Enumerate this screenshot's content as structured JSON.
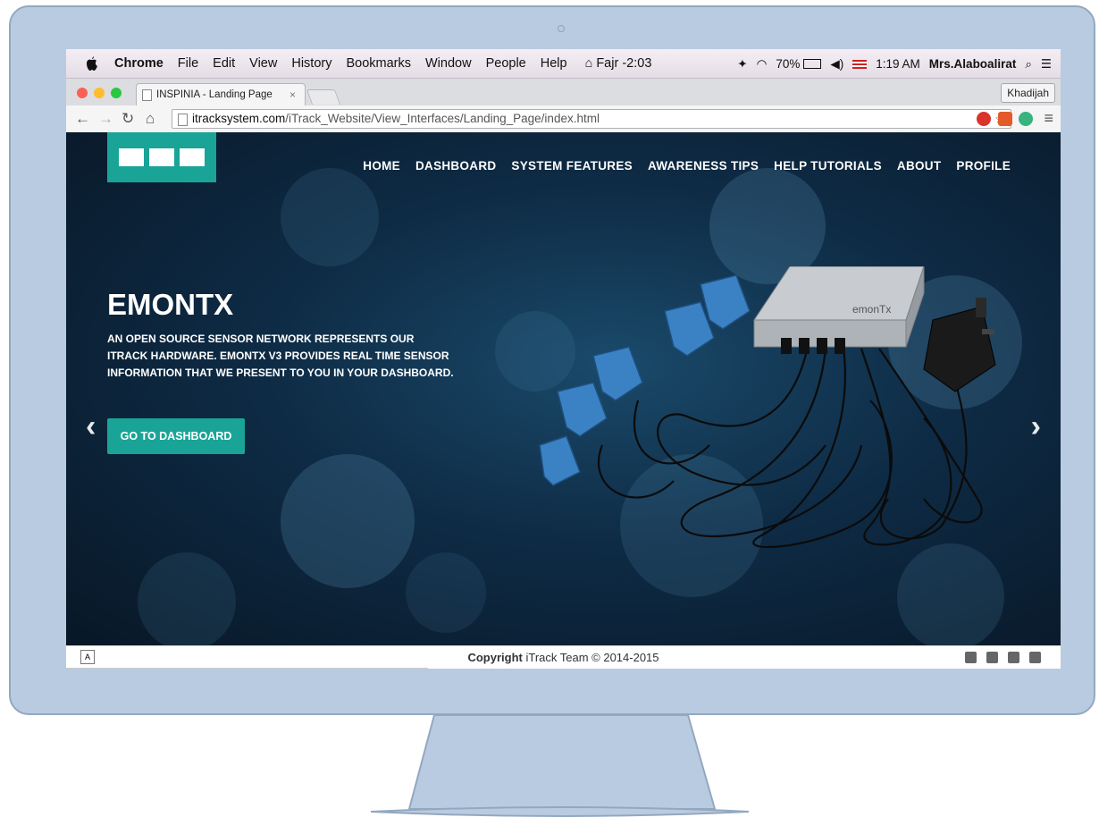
{
  "menubar": {
    "app": "Chrome",
    "items": [
      "File",
      "Edit",
      "View",
      "History",
      "Bookmarks",
      "Window",
      "People",
      "Help"
    ],
    "status": {
      "prayer": "Fajr -2:03",
      "battery": "70%",
      "time": "1:19 AM",
      "user": "Mrs.Alaboalirat"
    }
  },
  "browser": {
    "tab_title": "INSPINIA - Landing Page",
    "profile_name": "Khadijah",
    "url_host": "itracksystem.com",
    "url_path": "/iTrack_Website/View_Interfaces/Landing_Page/index.html"
  },
  "site": {
    "nav": [
      "HOME",
      "DASHBOARD",
      "SYSTEM FEATURES",
      "AWARENESS TIPS",
      "HELP TUTORIALS",
      "ABOUT",
      "PROFILE"
    ],
    "hero": {
      "title": "EMONTX",
      "text": "AN OPEN SOURCE SENSOR NETWORK REPRESENTS OUR ITRACK HARDWARE. EMONTX V3 PROVIDES REAL TIME SENSOR INFORMATION THAT WE PRESENT TO YOU IN YOUR DASHBOARD.",
      "cta": "GO TO DASHBOARD",
      "device_label": "emonTx"
    },
    "footer": {
      "copyright_bold": "Copyright",
      "copyright_text": " iTrack Team © 2014-2015"
    }
  },
  "colors": {
    "accent": "#1aa497",
    "monitor": "#b9cbe0",
    "sensor": "#3b82c4"
  }
}
